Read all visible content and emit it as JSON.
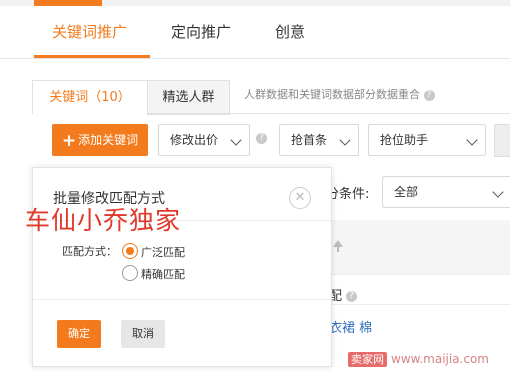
{
  "nav": {
    "tabs": [
      "关键词推广",
      "定向推广",
      "创意"
    ]
  },
  "subtabs": {
    "keywords_label": "关键词",
    "keywords_count": "（10）",
    "crowd_label": "精选人群"
  },
  "note": "人群数据和关键词数据部分数据重合",
  "toolbar": {
    "add_keyword": "添加关键词",
    "modify_bid": "修改出价",
    "grab_top": "抢首条",
    "rank_helper": "抢位助手"
  },
  "filter": {
    "label": "分条件:",
    "selected": "全部"
  },
  "table": {
    "row1_text": "配",
    "row2_text": "衣裙 棉"
  },
  "modal": {
    "title": "批量修改匹配方式",
    "watermark": "车仙小乔独家",
    "match_label": "匹配方式：",
    "options": [
      "广泛匹配",
      "精确匹配"
    ],
    "selected_option": "广泛匹配",
    "ok": "确定",
    "cancel": "取消"
  },
  "site_watermark": {
    "brand": "卖家网",
    "url": "www.maijia.com"
  },
  "colors": {
    "accent": "#f37b1d",
    "watermark_red": "#e0392a",
    "link_blue": "#2f6fbf"
  },
  "icons": [
    "help-icon",
    "close-icon",
    "plus-icon",
    "chevron-down-icon",
    "sort-up-icon"
  ]
}
